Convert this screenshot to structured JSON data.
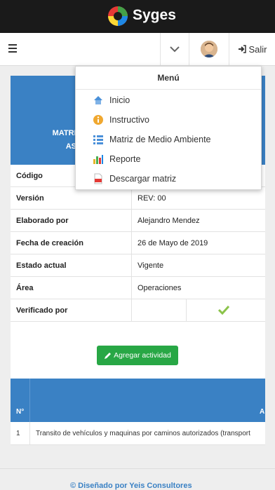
{
  "app": {
    "name": "Syges"
  },
  "navbar": {
    "logout_label": "Salir"
  },
  "menu": {
    "title": "Menú",
    "items": [
      {
        "label": "Inicio",
        "icon": "home-icon"
      },
      {
        "label": "Instructivo",
        "icon": "info-icon"
      },
      {
        "label": "Matriz de Medio Ambiente",
        "icon": "list-icon"
      },
      {
        "label": "Reporte",
        "icon": "bar-chart-icon"
      },
      {
        "label": "Descargar matriz",
        "icon": "pdf-icon"
      }
    ]
  },
  "header": {
    "line1": "MATRIZ",
    "line2": "ASP"
  },
  "details": [
    {
      "key": "Código",
      "value": ""
    },
    {
      "key": "Versión",
      "value": "REV: 00"
    },
    {
      "key": "Elaborado por",
      "value": "Alejandro Mendez"
    },
    {
      "key": "Fecha de creación",
      "value": "26 de Mayo de 2019"
    },
    {
      "key": "Estado actual",
      "value": "Vigente"
    },
    {
      "key": "Área",
      "value": "Operaciones"
    },
    {
      "key": "Verificado por",
      "value": ""
    }
  ],
  "actions": {
    "add_activity": "Agregar actividad"
  },
  "table": {
    "headers": {
      "no": "N°",
      "activity": "A"
    },
    "rows": [
      {
        "no": "1",
        "activity": "Transito de vehículos y maquinas por caminos autorizados (transport"
      }
    ]
  },
  "footer": {
    "text": "© Diseñado por Yeis Consultores"
  },
  "colors": {
    "header_blue": "#3a81c4",
    "button_green": "#28a745",
    "topbar": "#1a1a1a"
  }
}
